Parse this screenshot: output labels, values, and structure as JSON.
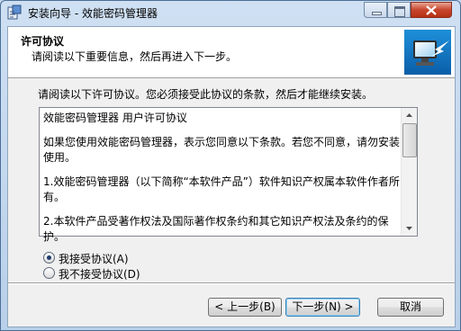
{
  "window": {
    "title": "安装向导 - 效能密码管理器"
  },
  "header": {
    "title": "许可协议",
    "subtitle": "请阅读以下重要信息，然后再进入下一步。"
  },
  "main": {
    "prompt": "请阅读以下许可协议。您必须接受此协议的条款，然后才能继续安装。",
    "license_paragraphs": [
      "效能密码管理器 用户许可协议",
      "如果您使用效能密码管理器，表示您同意以下条款。若您不同意，请勿安装使用。",
      "1.效能密码管理器（以下简称“本软件产品”）软件知识产权属本软件作者所有。",
      "2.本软件产品受著作权法及国际著作权条约和其它知识产权法及条约的保护。"
    ],
    "accept_label": "我接受协议(A)",
    "decline_label": "我不接受协议(D)",
    "accept_selected": true
  },
  "buttons": {
    "back": "< 上一步(B)",
    "next": "下一步(N) >",
    "cancel": "取消"
  }
}
